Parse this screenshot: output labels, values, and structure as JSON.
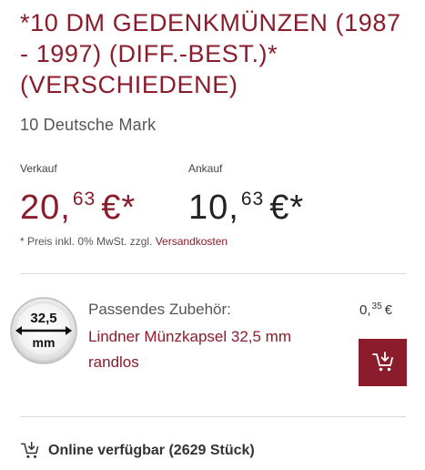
{
  "product": {
    "title": "*10 DM GEDENKMÜNZEN (1987 - 1997) (DIFF.-BEST.)* (VERSCHIEDENE)",
    "subtitle": "10 Deutsche Mark"
  },
  "prices": {
    "sell_label": "Verkauf",
    "sell_main": "20,",
    "sell_cents": "63",
    "sell_currency": "€*",
    "buy_label": "Ankauf",
    "buy_main": "10,",
    "buy_cents": "63",
    "buy_currency": "€*",
    "note_prefix": "* Preis inkl. 0% MwSt. zzgl. ",
    "shipping_link": "Versandkosten"
  },
  "accessory": {
    "label": "Passendes Zubehör:",
    "name": "Lindner Münzkapsel 32,5 mm randlos",
    "image_size": "32,5",
    "image_unit": "mm",
    "price_main": "0,",
    "price_cents": "35",
    "price_currency": "€",
    "cart_icon": "add-to-cart-icon"
  },
  "availability": {
    "text": "Online verfügbar (2629 Stück)",
    "icon": "cart-icon"
  },
  "colors": {
    "accent": "#8a1c2b",
    "text": "#333333",
    "divider": "#d9d9d9"
  }
}
